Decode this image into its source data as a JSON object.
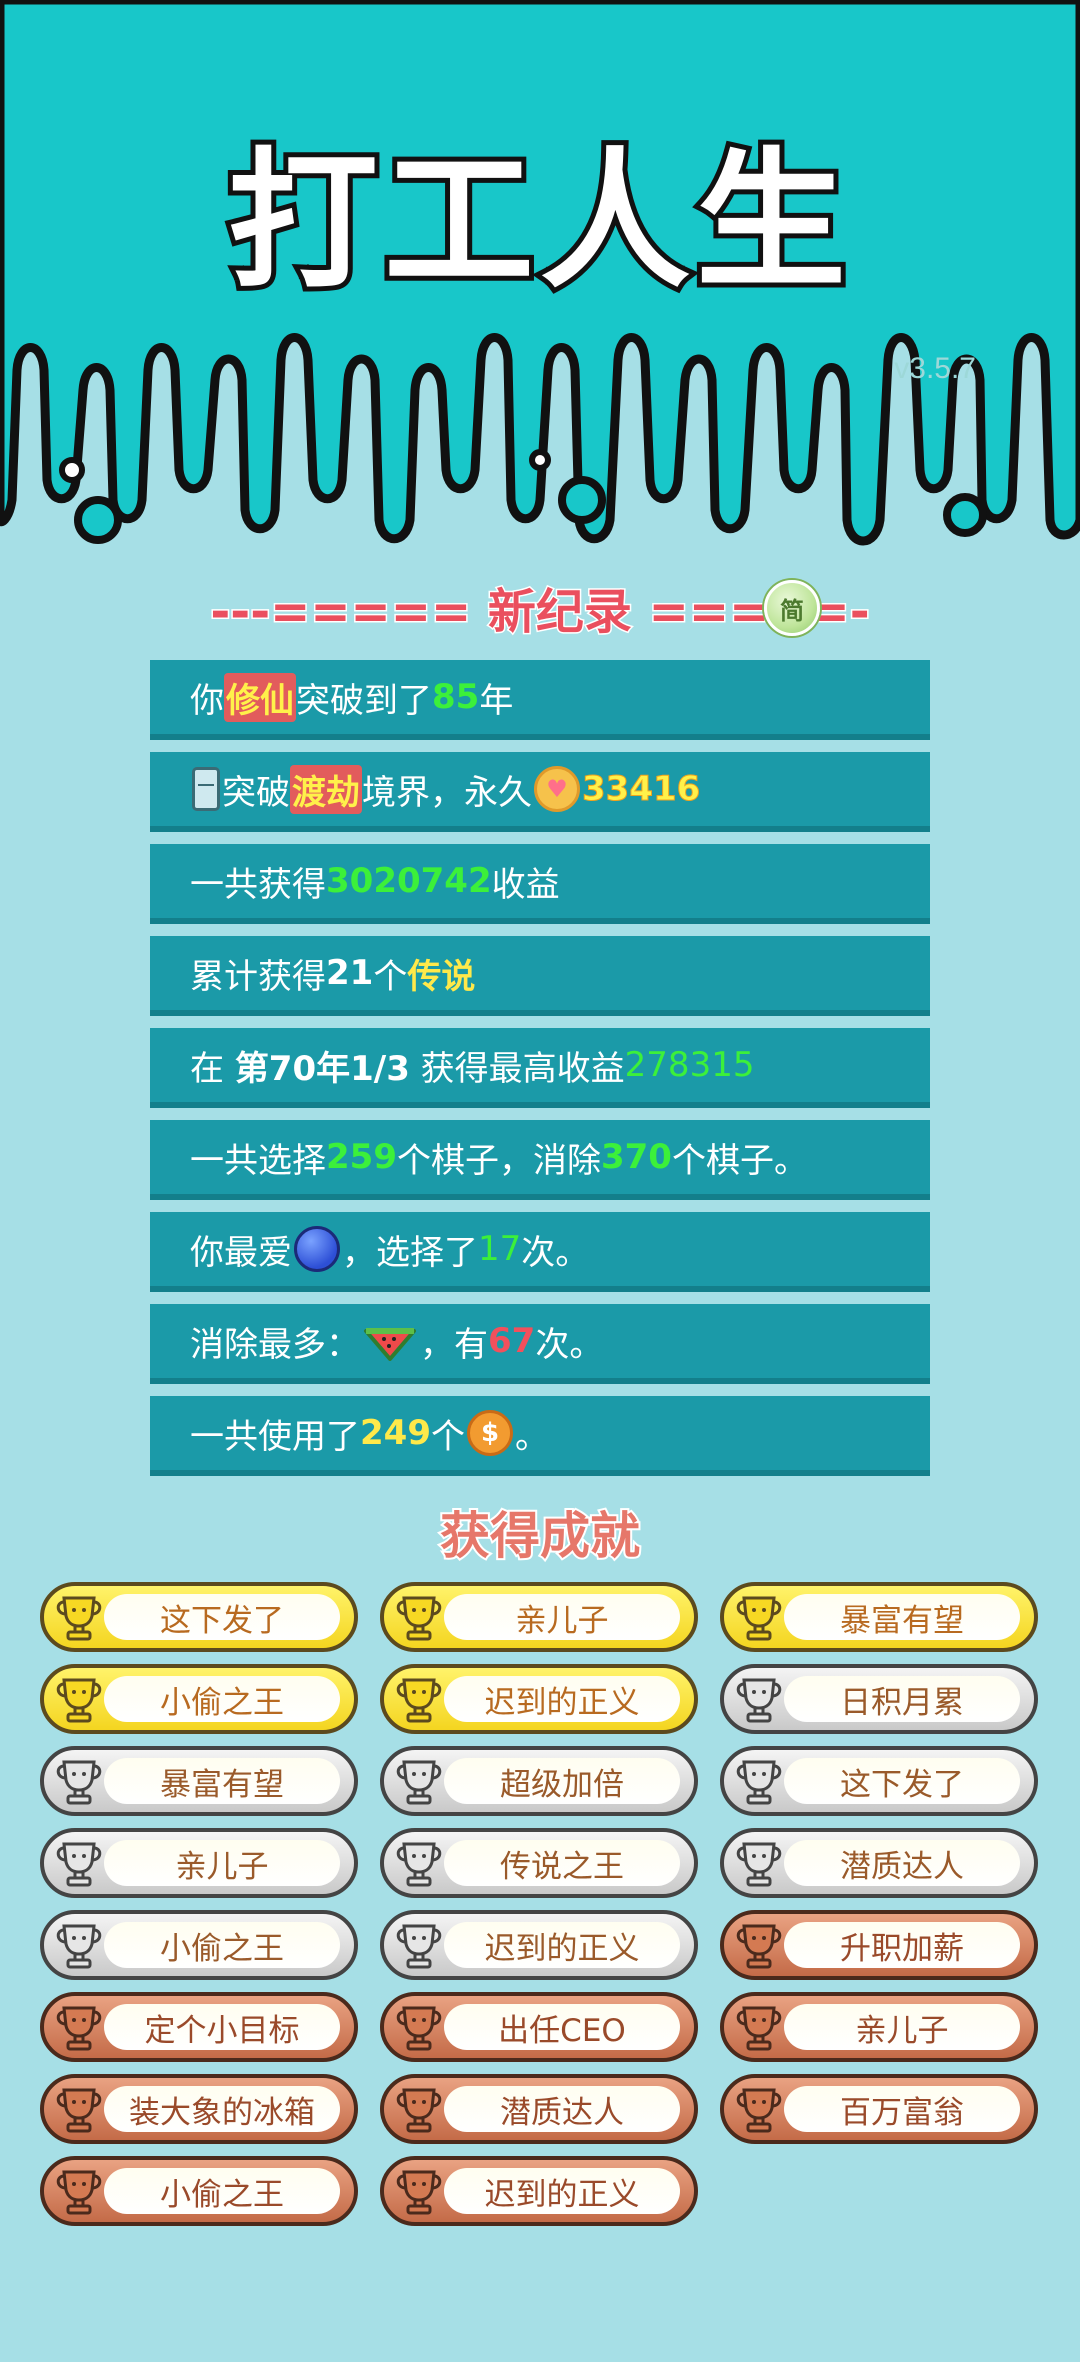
{
  "header": {
    "title": "打工人生",
    "version": "v3.5.7"
  },
  "record": {
    "title": "---===== 新纪录 =====-",
    "simplified_label": "简"
  },
  "stats": {
    "row1": {
      "a": "你",
      "b": "修仙",
      "c": "突破到了",
      "d": "85",
      "e": "年"
    },
    "row2": {
      "a": "突破",
      "b": "渡劫",
      "c": "境界，永久",
      "d": "33416"
    },
    "row3": {
      "a": "一共获得",
      "b": "3020742",
      "c": "收益"
    },
    "row4": {
      "a": "累计获得",
      "b": "21",
      "c": "个",
      "d": "传说"
    },
    "row5": {
      "a": "在 ",
      "b": "第70年1/3",
      "c": " 获得最高收益",
      "d": "278315"
    },
    "row6": {
      "a": "一共选择",
      "b": "259",
      "c": "个棋子，消除",
      "d": "370",
      "e": "个棋子。"
    },
    "row7": {
      "a": "你最爱",
      "b": "，选择了",
      "c": "17",
      "d": "次。"
    },
    "row8": {
      "a": "消除最多：",
      "b": "，有",
      "c": "67",
      "d": "次。"
    },
    "row9": {
      "a": "一共使用了",
      "b": "249",
      "c": "个",
      "d": "。"
    },
    "icons": {
      "row2_left": "fridge-icon",
      "row2_coin": "heart-coin-icon",
      "row7": "blueberry-icon",
      "row8": "watermelon-icon",
      "row9": "dollar-coin-icon"
    },
    "colors": {
      "highlight_yellow": "#fff14a",
      "green": "#3cf03a",
      "red": "#f2505c",
      "row_bg": "#1b9aa8"
    }
  },
  "achievements": {
    "title": "获得成就",
    "items": [
      {
        "label": "这下发了",
        "tier": "gold"
      },
      {
        "label": "亲儿子",
        "tier": "gold"
      },
      {
        "label": "暴富有望",
        "tier": "gold"
      },
      {
        "label": "小偷之王",
        "tier": "gold"
      },
      {
        "label": "迟到的正义",
        "tier": "gold"
      },
      {
        "label": "日积月累",
        "tier": "silver"
      },
      {
        "label": "暴富有望",
        "tier": "silver"
      },
      {
        "label": "超级加倍",
        "tier": "silver"
      },
      {
        "label": "这下发了",
        "tier": "silver"
      },
      {
        "label": "亲儿子",
        "tier": "silver"
      },
      {
        "label": "传说之王",
        "tier": "silver"
      },
      {
        "label": "潜质达人",
        "tier": "silver"
      },
      {
        "label": "小偷之王",
        "tier": "silver"
      },
      {
        "label": "迟到的正义",
        "tier": "silver"
      },
      {
        "label": "升职加薪",
        "tier": "bronze"
      },
      {
        "label": "定个小目标",
        "tier": "bronze"
      },
      {
        "label": "出任CEO",
        "tier": "bronze"
      },
      {
        "label": "亲儿子",
        "tier": "bronze"
      },
      {
        "label": "装大象的冰箱",
        "tier": "bronze"
      },
      {
        "label": "潜质达人",
        "tier": "bronze"
      },
      {
        "label": "百万富翁",
        "tier": "bronze"
      },
      {
        "label": "小偷之王",
        "tier": "bronze"
      },
      {
        "label": "迟到的正义",
        "tier": "bronze"
      }
    ]
  }
}
